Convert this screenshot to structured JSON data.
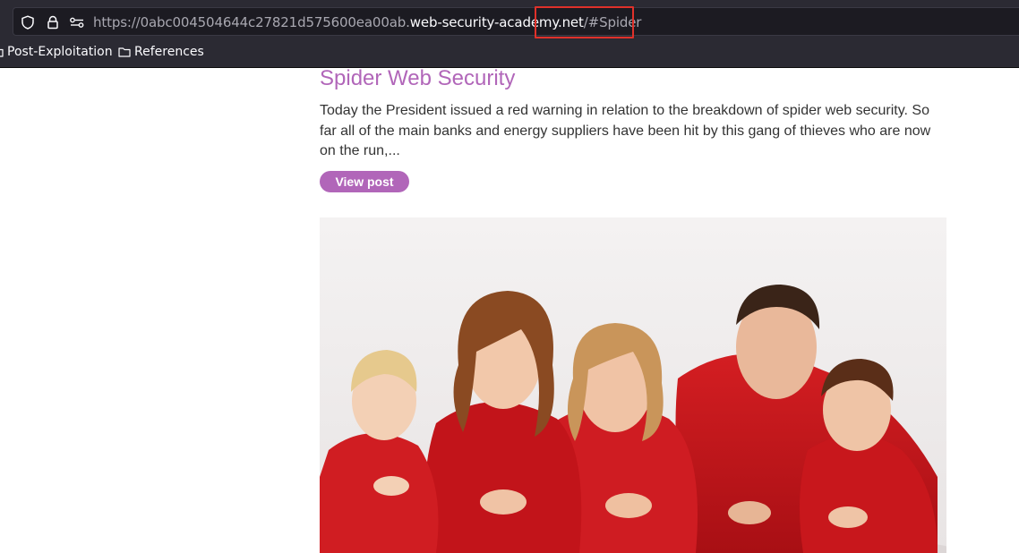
{
  "browser": {
    "url": {
      "prefix": "https://0abc004504644c27821d575600ea00ab.",
      "domain": "web-security-academy.net",
      "path": "/",
      "hash": "#Spider"
    },
    "bookmarks": [
      {
        "label": "Post-Exploitation",
        "icon": "folder-icon"
      },
      {
        "label": "References",
        "icon": "folder-icon"
      }
    ],
    "annotation_color": "#e0312a"
  },
  "post": {
    "title": "Spider Web Security",
    "summary": "Today the President issued a red warning in relation to the breakdown of spider web security. So far all of the main banks and energy suppliers have been hit by this gang of thieves who are now on the run,...",
    "button_label": "View post",
    "accent_color": "#b166b9"
  }
}
